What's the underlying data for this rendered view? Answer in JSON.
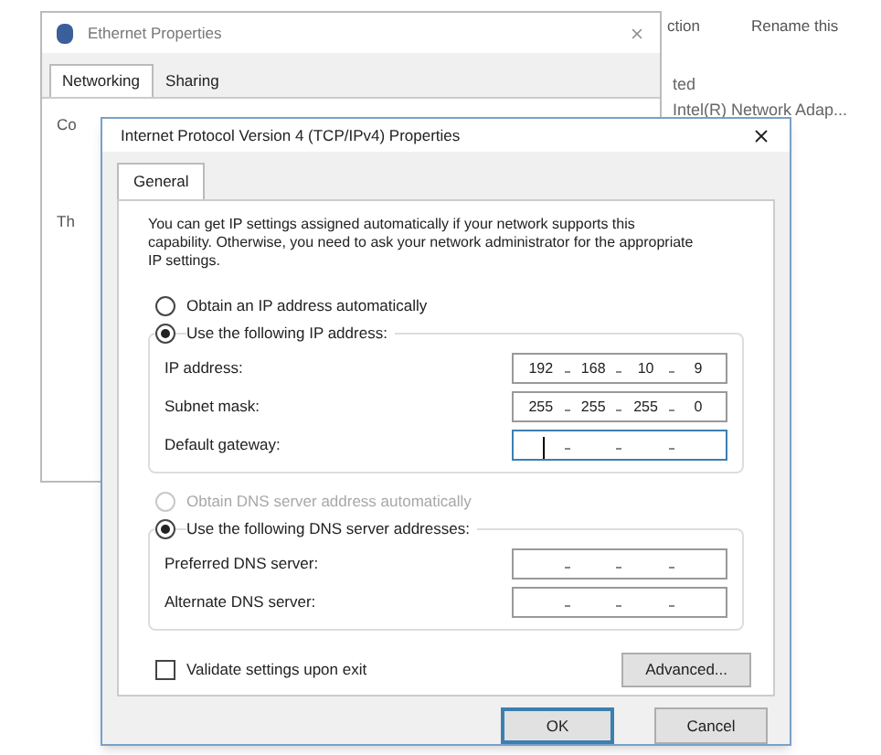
{
  "explorer": {
    "command_bar": [
      "ction",
      "Rename this"
    ],
    "adapter_lines": [
      "ted",
      "Intel(R) Network Adap..."
    ]
  },
  "background_window": {
    "title": "Ethernet Properties",
    "tabs": [
      {
        "label": "Networking",
        "selected": true
      },
      {
        "label": "Sharing",
        "selected": false
      }
    ],
    "labels": [
      "Co",
      "Th"
    ]
  },
  "dialog": {
    "title": "Internet Protocol Version 4 (TCP/IPv4) Properties",
    "tabs": [
      {
        "label": "General",
        "selected": true
      }
    ],
    "description": "You can get IP settings assigned automatically if your network supports this capability. Otherwise, you need to ask your network administrator for the appropriate IP settings.",
    "ip_mode": [
      {
        "label": "Obtain an IP address automatically",
        "selected": false,
        "disabled": false
      },
      {
        "label": "Use the following IP address:",
        "selected": true,
        "disabled": false
      }
    ],
    "ip_fields": [
      {
        "label": "IP address:",
        "octets": [
          "192",
          "168",
          "10",
          "9"
        ],
        "focused": false
      },
      {
        "label": "Subnet mask:",
        "octets": [
          "255",
          "255",
          "255",
          "0"
        ],
        "focused": false
      },
      {
        "label": "Default gateway:",
        "focused": true
      }
    ],
    "dns_mode": [
      {
        "label": "Obtain DNS server address automatically",
        "selected": false,
        "disabled": true
      },
      {
        "label": "Use the following DNS server addresses:",
        "selected": true,
        "disabled": false
      }
    ],
    "dns_fields": [
      {
        "label": "Preferred DNS server:",
        "focused": false
      },
      {
        "label": "Alternate DNS server:",
        "focused": false
      }
    ],
    "validate": {
      "label": "Validate settings upon exit",
      "checked": false
    },
    "advanced_button": "Advanced...",
    "buttons": [
      {
        "label": "OK",
        "default": true
      },
      {
        "label": "Cancel",
        "default": false
      }
    ]
  }
}
